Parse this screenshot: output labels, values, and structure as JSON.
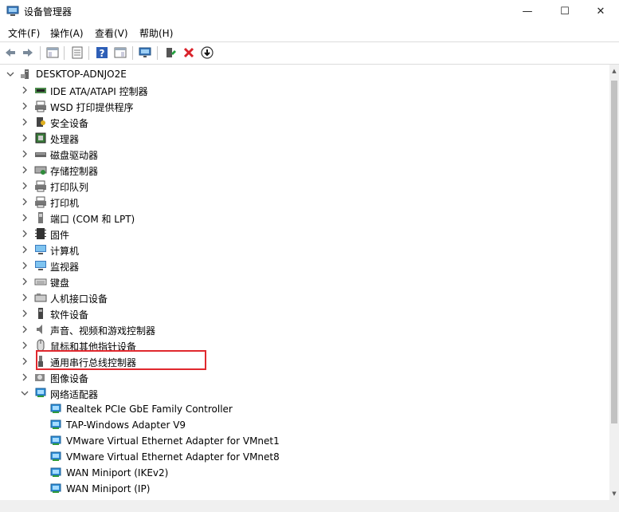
{
  "window": {
    "title": "设备管理器",
    "minimize_glyph": "—",
    "maximize_glyph": "☐",
    "close_glyph": "✕"
  },
  "menu": [
    "文件(F)",
    "操作(A)",
    "查看(V)",
    "帮助(H)"
  ],
  "toolbar": [
    "back-icon",
    "forward-icon",
    "show-hide-console-tree-icon",
    "properties-icon",
    "help-icon",
    "action-pane-icon",
    "scan-hardware-icon",
    "update-driver-icon",
    "uninstall-device-icon",
    "disable-device-icon"
  ],
  "tree": {
    "root": "DESKTOP-ADNJO2E",
    "categories": [
      {
        "label": "IDE ATA/ATAPI 控制器",
        "icon": "ide-controller-icon"
      },
      {
        "label": "WSD 打印提供程序",
        "icon": "wsd-printer-icon"
      },
      {
        "label": "安全设备",
        "icon": "security-device-icon"
      },
      {
        "label": "处理器",
        "icon": "processor-icon"
      },
      {
        "label": "磁盘驱动器",
        "icon": "disk-drive-icon"
      },
      {
        "label": "存储控制器",
        "icon": "storage-controller-icon"
      },
      {
        "label": "打印队列",
        "icon": "print-queue-icon"
      },
      {
        "label": "打印机",
        "icon": "printer-icon"
      },
      {
        "label": "端口 (COM 和 LPT)",
        "icon": "port-icon"
      },
      {
        "label": "固件",
        "icon": "firmware-icon"
      },
      {
        "label": "计算机",
        "icon": "computer-icon"
      },
      {
        "label": "监视器",
        "icon": "monitor-icon"
      },
      {
        "label": "键盘",
        "icon": "keyboard-icon"
      },
      {
        "label": "人机接口设备",
        "icon": "hid-icon"
      },
      {
        "label": "软件设备",
        "icon": "software-device-icon"
      },
      {
        "label": "声音、视频和游戏控制器",
        "icon": "sound-icon"
      },
      {
        "label": "鼠标和其他指针设备",
        "icon": "mouse-icon"
      },
      {
        "label": "通用串行总线控制器",
        "icon": "usb-icon"
      },
      {
        "label": "图像设备",
        "icon": "imaging-device-icon"
      },
      {
        "label": "网络适配器",
        "icon": "network-adapter-icon"
      }
    ],
    "network_adapters": [
      "Realtek PCIe GbE Family Controller",
      "TAP-Windows Adapter V9",
      "VMware Virtual Ethernet Adapter for VMnet1",
      "VMware Virtual Ethernet Adapter for VMnet8",
      "WAN Miniport (IKEv2)",
      "WAN Miniport (IP)"
    ]
  }
}
